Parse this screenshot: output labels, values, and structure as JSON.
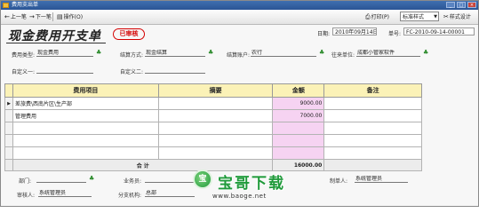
{
  "window": {
    "title": "费用支出单"
  },
  "toolbar": {
    "prev": "上一笔",
    "next": "下一笔",
    "operate": "操作(O)",
    "print": "打印(P)",
    "style_value": "标准样式",
    "design": "样式设计"
  },
  "header": {
    "title": "现金费用开支单",
    "stamp": "已审核",
    "date_label": "日期:",
    "date_value": "2010年09月14日",
    "no_label": "单号:",
    "no_value": "FC-2010-09-14-00001"
  },
  "form": {
    "expense_type_label": "费用类型:",
    "expense_type_value": "现金费用",
    "settle_label": "结算方式:",
    "settle_value": "现金结算",
    "account_label": "结算账户:",
    "account_value": "农行",
    "company_label": "往来单位:",
    "company_value": "成都小管家软件",
    "custom1_label": "自定义一:",
    "custom2_label": "自定义二:"
  },
  "grid": {
    "headers": [
      "费用项目",
      "摘要",
      "金额",
      "备注"
    ],
    "rows": [
      {
        "item": "差旅费\\西南片区\\生产部",
        "summary": "",
        "amount": "9000.00",
        "note": ""
      },
      {
        "item": "管理费用",
        "summary": "",
        "amount": "7000.00",
        "note": ""
      },
      {
        "item": "",
        "summary": "",
        "amount": "",
        "note": ""
      },
      {
        "item": "",
        "summary": "",
        "amount": "",
        "note": ""
      },
      {
        "item": "",
        "summary": "",
        "amount": "",
        "note": ""
      }
    ],
    "total_label": "合 计",
    "total_amount": "16000.00"
  },
  "footer": {
    "dept_label": "部门:",
    "clerk_label": "业务员:",
    "maker_label": "制单人:",
    "maker_value": "系统管理员",
    "auditor_label": "审核人:",
    "auditor_value": "系统管理员",
    "branch_label": "分支机构:",
    "branch_value": "总部"
  },
  "watermark": {
    "text": "宝哥下载",
    "url": "www.baoge.net"
  }
}
